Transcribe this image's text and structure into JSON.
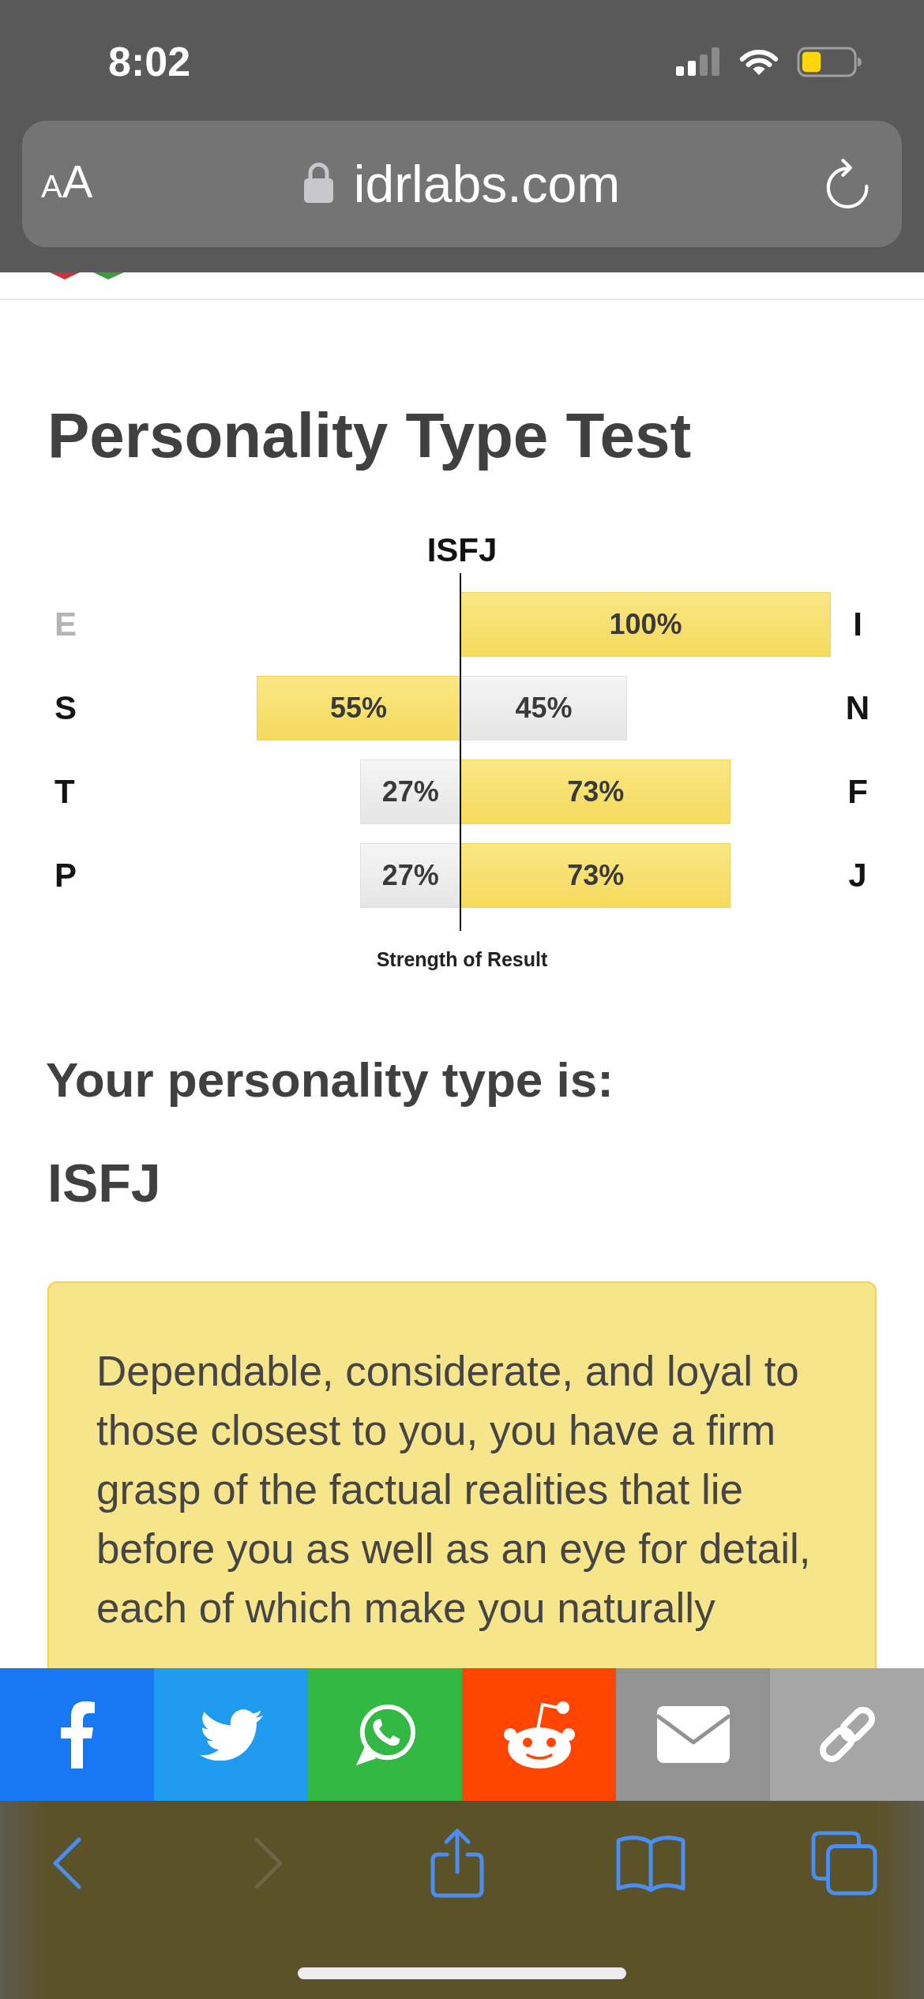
{
  "status_bar": {
    "time": "8:02"
  },
  "address_bar": {
    "text_size_button": "AA",
    "url": "idrlabs.com"
  },
  "page": {
    "title": "Personality Type Test",
    "chart": {
      "title": "ISFJ",
      "caption": "Strength of Result",
      "rows": [
        {
          "left": {
            "letter": "E",
            "dimmed": true
          },
          "right": {
            "letter": "I",
            "dimmed": false,
            "selected": true,
            "value": "100%"
          }
        },
        {
          "left": {
            "letter": "S",
            "dimmed": false,
            "selected": true,
            "value": "55%"
          },
          "right": {
            "letter": "N",
            "dimmed": false,
            "selected": false,
            "value": "45%"
          }
        },
        {
          "left": {
            "letter": "T",
            "dimmed": false,
            "selected": false,
            "value": "27%"
          },
          "right": {
            "letter": "F",
            "dimmed": false,
            "selected": true,
            "value": "73%"
          }
        },
        {
          "left": {
            "letter": "P",
            "dimmed": false,
            "selected": false,
            "value": "27%"
          },
          "right": {
            "letter": "J",
            "dimmed": false,
            "selected": true,
            "value": "73%"
          }
        }
      ]
    },
    "result_heading": "Your personality type is:",
    "result_type": "ISFJ",
    "description": "Dependable, considerate, and loyal to those closest to you, you have a firm grasp of the factual realities that lie before you as well as an eye for detail, each of which make you naturally"
  },
  "share_buttons": [
    {
      "kind": "facebook",
      "color": "#1877f2"
    },
    {
      "kind": "twitter",
      "color": "#1f9bf0"
    },
    {
      "kind": "whatsapp",
      "color": "#33b843"
    },
    {
      "kind": "reddit",
      "color": "#ff4500"
    },
    {
      "kind": "email",
      "color": "#939393"
    },
    {
      "kind": "link",
      "color": "#a6a6a6"
    }
  ],
  "toolbar": [
    {
      "kind": "back",
      "disabled": false
    },
    {
      "kind": "forward",
      "disabled": true
    },
    {
      "kind": "share",
      "disabled": false
    },
    {
      "kind": "bookmarks",
      "disabled": false
    },
    {
      "kind": "tabs",
      "disabled": false
    }
  ]
}
